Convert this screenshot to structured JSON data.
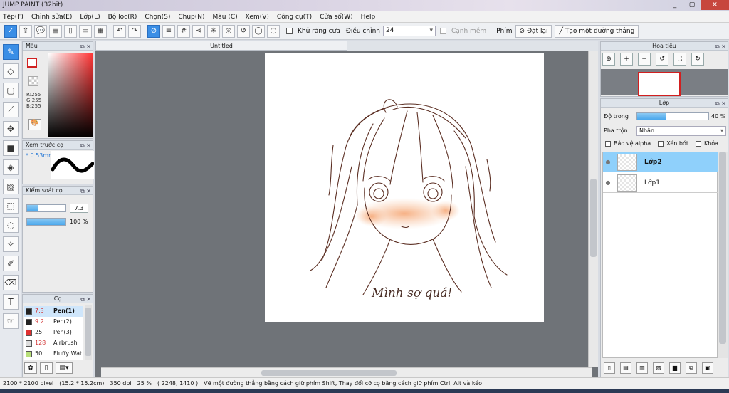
{
  "window": {
    "title": "JUMP PAINT (32bit)",
    "min": "_",
    "max": "▢",
    "close": "✕"
  },
  "menu": [
    "Tệp(F)",
    "Chỉnh sửa(E)",
    "Lớp(L)",
    "Bộ lọc(R)",
    "Chọn(S)",
    "Chụp(N)",
    "Màu (C)",
    "Xem(V)",
    "Công cụ(T)",
    "Cửa sổ(W)",
    "Help"
  ],
  "toolbar": {
    "antialias_label": "Khử răng cưa",
    "adjust_label": "Điều chỉnh",
    "adjust_value": "24",
    "smooth_label": "Cạnh mềm",
    "key_label": "Phím",
    "reset_label": "Đặt lại",
    "straight_label": "Tạo một đường thẳng"
  },
  "color_panel": {
    "title": "Màu",
    "r": "R:255",
    "g": "G:255",
    "b": "B:255"
  },
  "brush_preview": {
    "title": "Xem trước cọ",
    "size": "* 0.53mm"
  },
  "control": {
    "title": "Kiểm soát cọ",
    "size_value": "7.3",
    "size_fraction": 0.3,
    "opacity_label": "100 %",
    "opacity_fraction": 1.0
  },
  "brush_list": {
    "title": "Cọ",
    "items": [
      {
        "size": "7.3",
        "name": "Pen(1)",
        "color": "#222222"
      },
      {
        "size": "9.2",
        "name": "Pen(2)",
        "color": "#222222"
      },
      {
        "size": "25",
        "name": "Pen(3)",
        "color": "#e03030"
      },
      {
        "size": "128",
        "name": "Airbrush",
        "color": "#dddddd"
      },
      {
        "size": "50",
        "name": "Fluffy Wat",
        "color": "#b8e07a"
      }
    ]
  },
  "document": {
    "tab": "Untitled",
    "caption": "Mình sợ quá!"
  },
  "navigator": {
    "title": "Hoa tiêu"
  },
  "layers": {
    "title": "Lớp",
    "opacity_label": "Độ trong",
    "opacity_value": "40 %",
    "opacity_fraction": 0.4,
    "blend_label": "Pha trộn",
    "blend_value": "Nhân",
    "protect_alpha": "Bảo vệ alpha",
    "clip": "Xén bớt",
    "lock": "Khóa",
    "items": [
      {
        "name": "Lớp2",
        "selected": true
      },
      {
        "name": "Lớp1",
        "selected": false
      }
    ]
  },
  "status": {
    "size": "2100 * 2100 pixel",
    "cm": "(15.2 * 15.2cm)",
    "dpi": "350 dpi",
    "zoom": "25 %",
    "coords": "( 2248, 1410 )",
    "hint": "Vẽ một đường thẳng bằng cách giữ phím Shift, Thay đổi cỡ cọ bằng cách giữ phím Ctrl, Alt và kéo"
  },
  "colors": {
    "accent": "#3a8ee6",
    "canvas_bg": "#6f7378",
    "layer_selected": "#8fd0fb"
  }
}
